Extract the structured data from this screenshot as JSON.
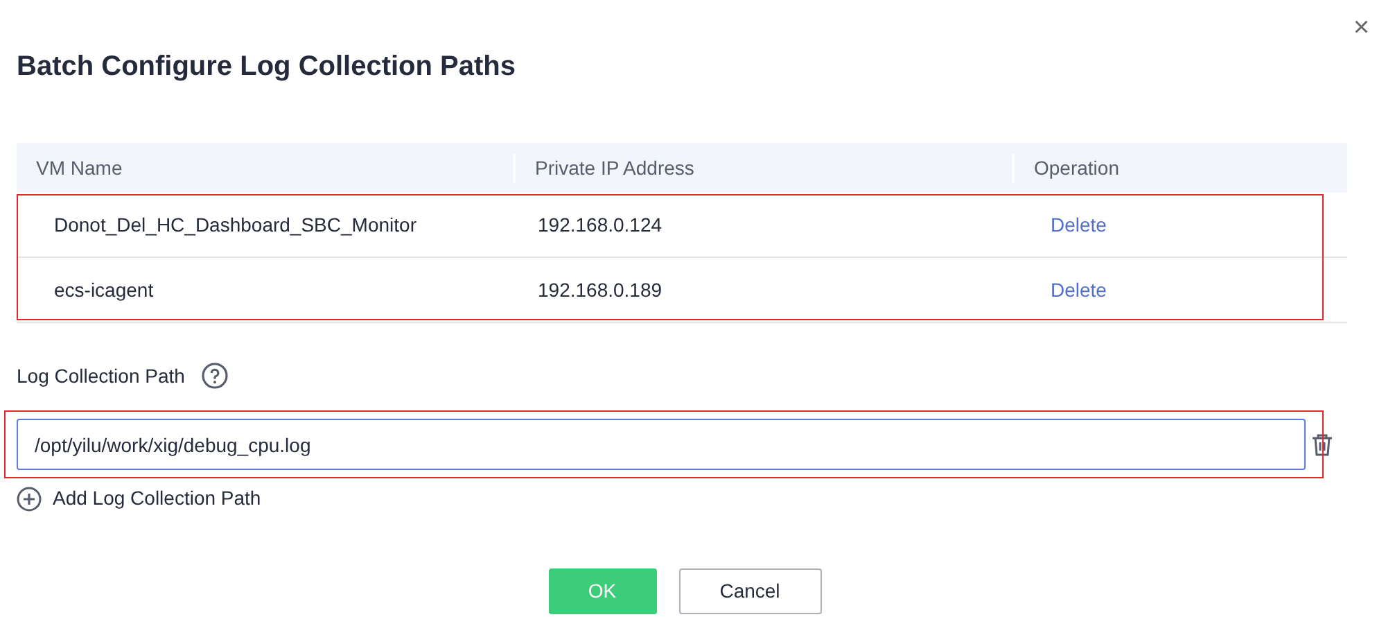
{
  "dialog": {
    "title": "Batch Configure Log Collection Paths",
    "close": "×"
  },
  "table": {
    "columns": [
      "VM Name",
      "Private IP Address",
      "Operation"
    ],
    "rows": [
      {
        "name": "Donot_Del_HC_Dashboard_SBC_Monitor",
        "ip": "192.168.0.124",
        "action": "Delete"
      },
      {
        "name": "ecs-icagent",
        "ip": "192.168.0.189",
        "action": "Delete"
      }
    ]
  },
  "path_label": "Log Collection Path",
  "paths": [
    {
      "value": "/opt/yilu/work/xig/debug_cpu.log"
    }
  ],
  "add_link": "Add Log Collection Path",
  "buttons": [
    {
      "label": "OK",
      "kind": "primary"
    },
    {
      "label": "Cancel",
      "kind": "secondary"
    }
  ]
}
